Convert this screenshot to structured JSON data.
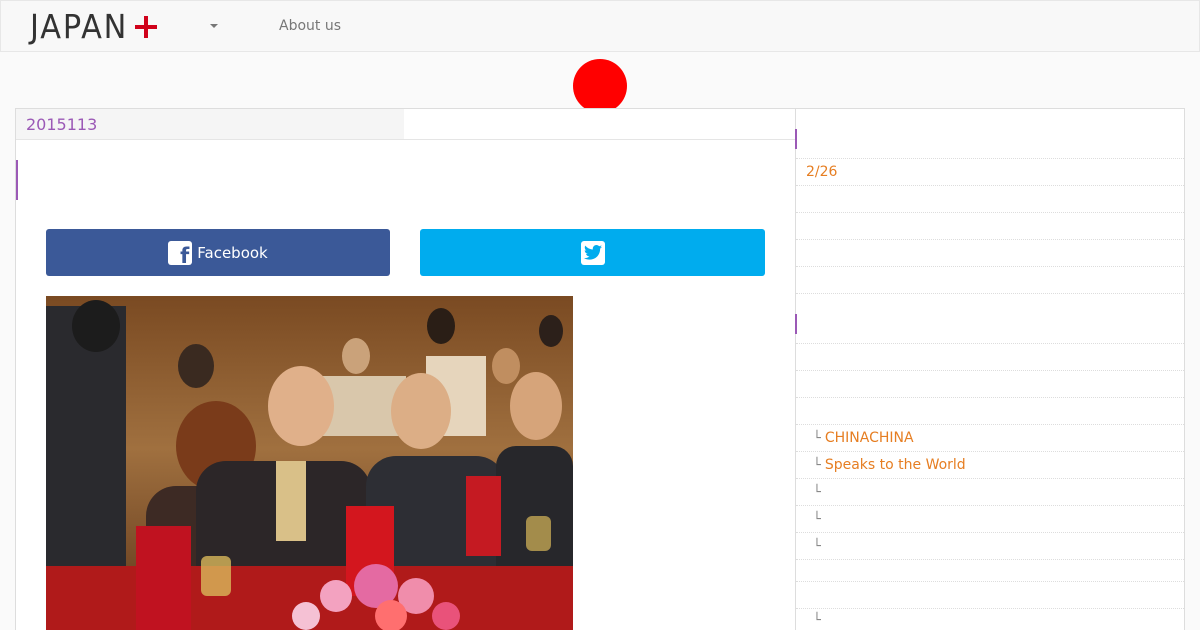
{
  "nav": {
    "logo": "JAPAN",
    "about": "About us"
  },
  "article": {
    "date": "2015113",
    "facebook_label": "Facebook"
  },
  "sidebar": {
    "date": "2/26",
    "items": [
      "CHINACHINA",
      "Speaks to the World",
      "",
      "",
      "",
      ""
    ],
    "branch": "└"
  },
  "colors": {
    "brand_red": "#d0021b",
    "facebook": "#3b5998",
    "twitter": "#00acee",
    "accent_purple": "#9b59b6",
    "accent_orange": "#e67e22"
  }
}
